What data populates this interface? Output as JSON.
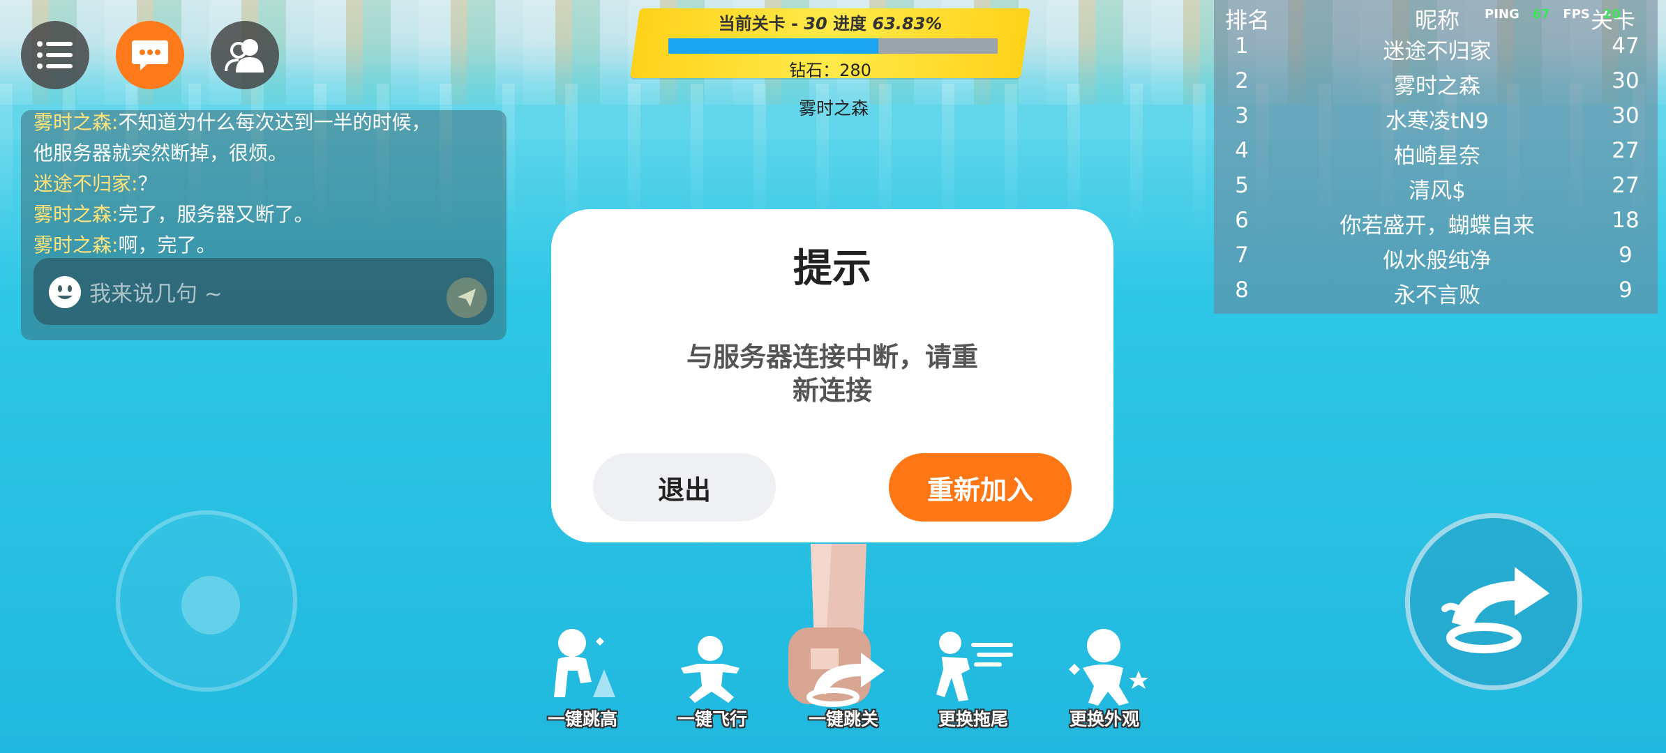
{
  "menu": {
    "list_icon": "menu-list-icon",
    "chat_icon": "chat-bubble-icon",
    "friends_icon": "friends-icon"
  },
  "chat": {
    "messages": [
      {
        "user": "雾时之森:",
        "text": "不知道为什么每次达到一半的时候，"
      },
      {
        "user": "",
        "text": "他服务器就突然断掉，很烦。"
      },
      {
        "user": "迷途不归家:",
        "text": "？"
      },
      {
        "user": "雾时之森:",
        "text": "完了，服务器又断了。"
      },
      {
        "user": "雾时之森:",
        "text": "啊，完了。"
      }
    ],
    "input_placeholder": "我来说几句 ~"
  },
  "level": {
    "current_label": "当前关卡 - ",
    "current_level": "30",
    "progress_label": " 进度 ",
    "progress_text": "63.83%",
    "progress_value": 0.6383,
    "diamonds": "钻石：280",
    "player_name": "雾时之森"
  },
  "netstat": {
    "ping_label": "PING",
    "ping_value": "67",
    "fps_label": "FPS",
    "fps_value": "20"
  },
  "leaderboard": {
    "headers": {
      "rank": "排名",
      "name": "昵称",
      "level": "关卡"
    },
    "rows": [
      {
        "rank": "1",
        "name": "迷途不归家",
        "level": "47"
      },
      {
        "rank": "2",
        "name": "雾时之森",
        "level": "30"
      },
      {
        "rank": "3",
        "name": "水寒凌tN9",
        "level": "30"
      },
      {
        "rank": "4",
        "name": "柏崎星奈",
        "level": "27"
      },
      {
        "rank": "5",
        "name": "清风$",
        "level": "27"
      },
      {
        "rank": "6",
        "name": "你若盛开，蝴蝶自来",
        "level": "18"
      },
      {
        "rank": "7",
        "name": "似水般纯净",
        "level": "9"
      },
      {
        "rank": "8",
        "name": "永不言败",
        "level": "9"
      }
    ]
  },
  "dialog": {
    "title": "提示",
    "message_line1": "与服务器连接中断，请重",
    "message_line2": "新连接",
    "exit_label": "退出",
    "rejoin_label": "重新加入"
  },
  "skills": [
    {
      "label": "一键跳高",
      "icon": "jump-high-icon"
    },
    {
      "label": "一键飞行",
      "icon": "fly-icon"
    },
    {
      "label": "一键跳关",
      "icon": "skip-level-icon"
    },
    {
      "label": "更换拖尾",
      "icon": "trail-icon"
    },
    {
      "label": "更换外观",
      "icon": "outfit-icon"
    }
  ],
  "colors": {
    "accent": "#ff7614",
    "progress": "#1aa3ef",
    "banner": "#ffd21a",
    "chat_user": "#ffe27a"
  }
}
